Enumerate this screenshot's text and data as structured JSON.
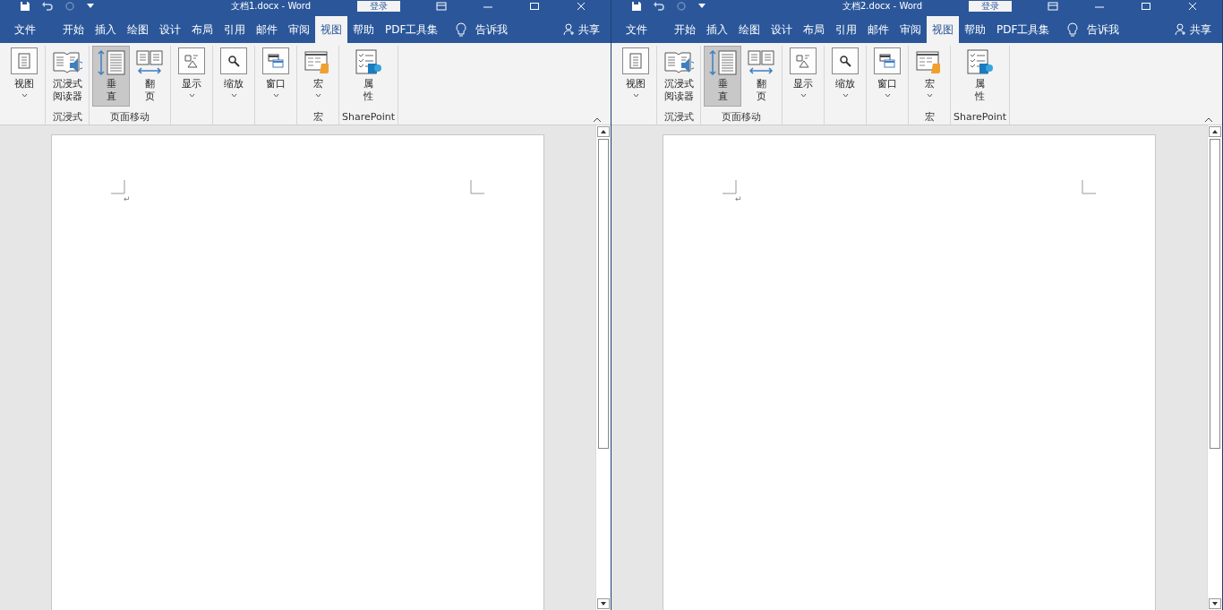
{
  "windows": [
    {
      "title": "文档1.docx  -  Word",
      "login": "登录",
      "tabs": [
        {
          "label": "文件",
          "selected": false
        },
        {
          "label": "开始",
          "selected": false
        },
        {
          "label": "插入",
          "selected": false
        },
        {
          "label": "绘图",
          "selected": false
        },
        {
          "label": "设计",
          "selected": false
        },
        {
          "label": "布局",
          "selected": false
        },
        {
          "label": "引用",
          "selected": false
        },
        {
          "label": "邮件",
          "selected": false
        },
        {
          "label": "审阅",
          "selected": false
        },
        {
          "label": "视图",
          "selected": true
        },
        {
          "label": "帮助",
          "selected": false
        },
        {
          "label": "PDF工具集",
          "selected": false
        }
      ],
      "tell_me": "告诉我",
      "share": "共享",
      "groups": [
        {
          "buttons": [
            {
              "kind": "view",
              "lines": [
                "视图"
              ],
              "dropdown": true,
              "selected": false
            }
          ]
        },
        {
          "label": "沉浸式",
          "buttons": [
            {
              "kind": "reader",
              "lines": [
                "沉浸式",
                "阅读器"
              ],
              "dropdown": false,
              "selected": false
            }
          ]
        },
        {
          "label": "页面移动",
          "buttons": [
            {
              "kind": "vertical",
              "lines": [
                "垂",
                "直"
              ],
              "dropdown": false,
              "selected": true
            },
            {
              "kind": "flip",
              "lines": [
                "翻",
                "页"
              ],
              "dropdown": false,
              "selected": false
            }
          ]
        },
        {
          "buttons": [
            {
              "kind": "show",
              "lines": [
                "显示"
              ],
              "dropdown": true,
              "selected": false
            }
          ]
        },
        {
          "buttons": [
            {
              "kind": "zoom",
              "lines": [
                "缩放"
              ],
              "dropdown": true,
              "selected": false
            }
          ]
        },
        {
          "buttons": [
            {
              "kind": "window",
              "lines": [
                "窗口"
              ],
              "dropdown": true,
              "selected": false
            }
          ]
        },
        {
          "label": "宏",
          "buttons": [
            {
              "kind": "macro",
              "lines": [
                "宏"
              ],
              "dropdown": true,
              "selected": false
            }
          ]
        },
        {
          "label": "SharePoint",
          "buttons": [
            {
              "kind": "properties",
              "lines": [
                "属",
                "性"
              ],
              "dropdown": false,
              "selected": false
            }
          ]
        }
      ],
      "paragraph_mark": "↵"
    },
    {
      "title": "文档2.docx  -  Word",
      "login": "登录",
      "tabs": [
        {
          "label": "文件",
          "selected": false
        },
        {
          "label": "开始",
          "selected": false
        },
        {
          "label": "插入",
          "selected": false
        },
        {
          "label": "绘图",
          "selected": false
        },
        {
          "label": "设计",
          "selected": false
        },
        {
          "label": "布局",
          "selected": false
        },
        {
          "label": "引用",
          "selected": false
        },
        {
          "label": "邮件",
          "selected": false
        },
        {
          "label": "审阅",
          "selected": false
        },
        {
          "label": "视图",
          "selected": true
        },
        {
          "label": "帮助",
          "selected": false
        },
        {
          "label": "PDF工具集",
          "selected": false
        }
      ],
      "tell_me": "告诉我",
      "share": "共享",
      "groups": [
        {
          "buttons": [
            {
              "kind": "view",
              "lines": [
                "视图"
              ],
              "dropdown": true,
              "selected": false
            }
          ]
        },
        {
          "label": "沉浸式",
          "buttons": [
            {
              "kind": "reader",
              "lines": [
                "沉浸式",
                "阅读器"
              ],
              "dropdown": false,
              "selected": false
            }
          ]
        },
        {
          "label": "页面移动",
          "buttons": [
            {
              "kind": "vertical",
              "lines": [
                "垂",
                "直"
              ],
              "dropdown": false,
              "selected": true
            },
            {
              "kind": "flip",
              "lines": [
                "翻",
                "页"
              ],
              "dropdown": false,
              "selected": false
            }
          ]
        },
        {
          "buttons": [
            {
              "kind": "show",
              "lines": [
                "显示"
              ],
              "dropdown": true,
              "selected": false
            }
          ]
        },
        {
          "buttons": [
            {
              "kind": "zoom",
              "lines": [
                "缩放"
              ],
              "dropdown": true,
              "selected": false
            }
          ]
        },
        {
          "buttons": [
            {
              "kind": "window",
              "lines": [
                "窗口"
              ],
              "dropdown": true,
              "selected": false
            }
          ]
        },
        {
          "label": "宏",
          "buttons": [
            {
              "kind": "macro",
              "lines": [
                "宏"
              ],
              "dropdown": true,
              "selected": false
            }
          ]
        },
        {
          "label": "SharePoint",
          "buttons": [
            {
              "kind": "properties",
              "lines": [
                "属",
                "性"
              ],
              "dropdown": false,
              "selected": false
            }
          ]
        }
      ],
      "paragraph_mark": "↵"
    }
  ]
}
